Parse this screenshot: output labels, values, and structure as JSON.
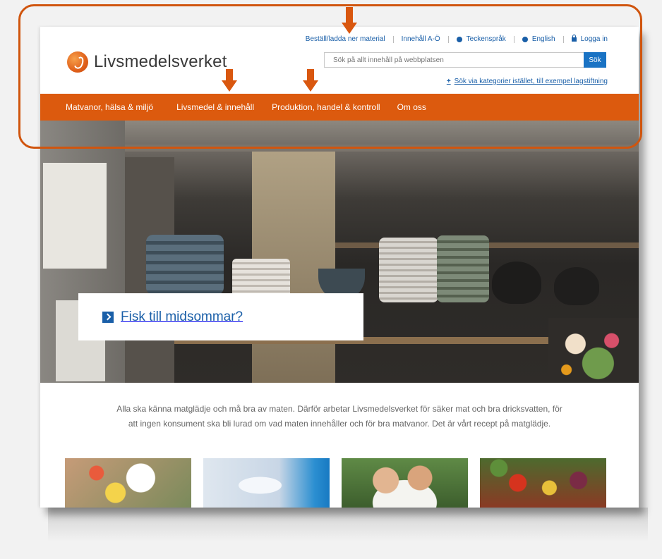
{
  "site": {
    "logo_text": "Livsmedelsverket"
  },
  "toplinks": {
    "order": "Beställ/ladda ner material",
    "az": "Innehåll A-Ö",
    "sign": "Teckenspråk",
    "english": "English",
    "login": "Logga in"
  },
  "search": {
    "placeholder": "Sök på allt innehåll på webbplatsen",
    "button": "Sök",
    "category_link": "Sök via kategorier istället, till exempel lagstiftning"
  },
  "nav": {
    "items": [
      {
        "label": "Matvanor, hälsa & miljö"
      },
      {
        "label": "Livsmedel & innehåll"
      },
      {
        "label": "Produktion, handel & kontroll"
      },
      {
        "label": "Om oss"
      }
    ]
  },
  "hero": {
    "promo_text": "Fisk till midsommar?"
  },
  "intro": {
    "line1": "Alla ska känna matglädje och må bra av maten. Därför arbetar Livsmedelsverket för säker mat och bra dricksvatten, för",
    "line2": "att ingen konsument ska bli lurad om vad maten innehåller och för bra matvanor. Det är vårt recept på matglädje."
  },
  "colors": {
    "nav_bg": "#dc5a0e",
    "link_blue": "#1a5fa8",
    "search_button": "#1a73c4",
    "annotation": "#d0550e"
  },
  "icons": {
    "logo": "livsmedelsverket-logo-icon",
    "sign": "sign-language-icon",
    "globe": "globe-icon",
    "lock": "lock-icon",
    "plus": "plus-icon",
    "chevron": "chevron-right-icon",
    "annotation_arrow": "arrow-down-icon"
  }
}
